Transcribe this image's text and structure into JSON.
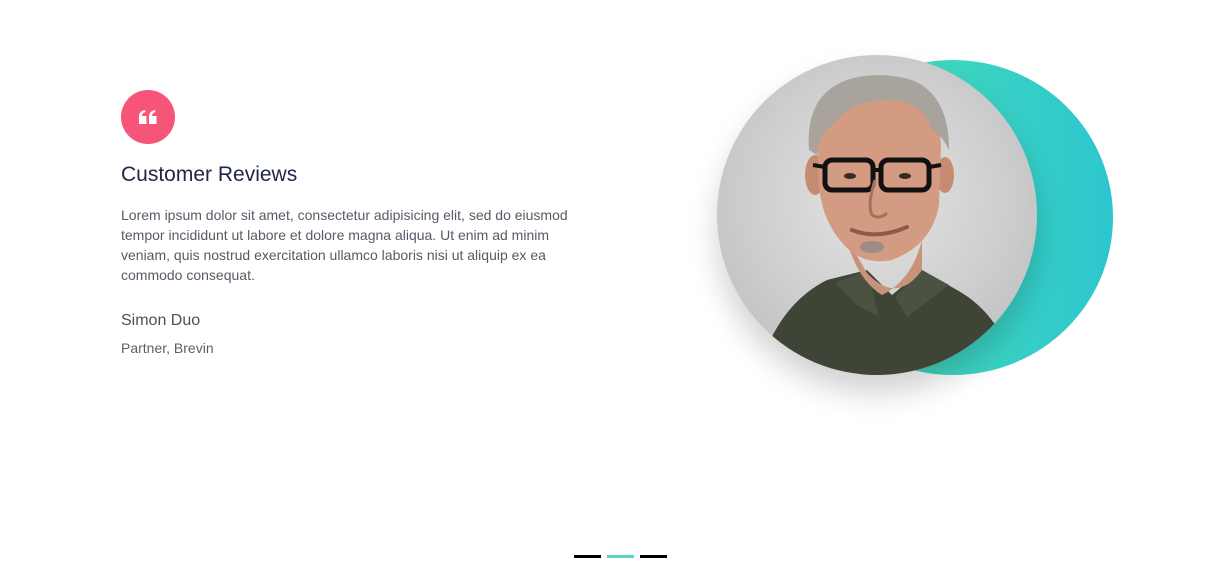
{
  "testimonial": {
    "heading": "Customer Reviews",
    "body": "Lorem ipsum dolor sit amet, consectetur adipisicing elit, sed do eiusmod tempor incididunt ut labore et dolore magna aliqua. Ut enim ad minim veniam, quis nostrud exercitation ullamco laboris nisi ut aliquip ex ea commodo consequat.",
    "author_name": "Simon Duo",
    "author_role": "Partner, Brevin",
    "quote_icon": "quote-left-icon",
    "photo_alt": "portrait"
  },
  "carousel": {
    "slide_count": 3,
    "active_index": 1
  },
  "colors": {
    "accent_pink": "#f7547a",
    "accent_teal": "#3fd6bf",
    "heading": "#1f2547",
    "active_dot": "#5fd1c6"
  }
}
